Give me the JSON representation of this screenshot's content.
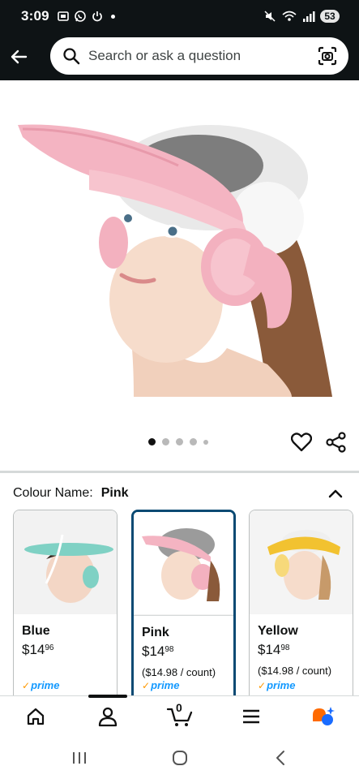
{
  "status_bar": {
    "time": "3:09",
    "battery": "53"
  },
  "search": {
    "placeholder": "Search or ask a question"
  },
  "product": {
    "image_alt": "Child wearing pink shower cap with ear covers",
    "carousel": {
      "count": 5,
      "active": 1
    }
  },
  "colour": {
    "label": "Colour Name:",
    "selected": "Pink",
    "options": [
      {
        "name": "Blue",
        "price_dollars": "$14",
        "price_cents": "96",
        "unit_price": "",
        "prime": "prime",
        "color": "#7fd1c4"
      },
      {
        "name": "Pink",
        "price_dollars": "$14",
        "price_cents": "98",
        "unit_price": "($14.98 / count)",
        "prime": "prime",
        "color": "#f2b6c0"
      },
      {
        "name": "Yellow",
        "price_dollars": "$14",
        "price_cents": "98",
        "unit_price": "($14.98 / count)",
        "prime": "prime",
        "color": "#f2c230"
      }
    ]
  },
  "bottom_nav": {
    "cart_count": "0",
    "items": [
      "home-icon",
      "account-icon",
      "cart-icon",
      "menu-icon",
      "rufus-icon"
    ]
  },
  "system_nav": {
    "items": [
      "recents-icon",
      "home-icon",
      "back-icon"
    ]
  },
  "colors": {
    "header_bg": "#0e1315",
    "selected_border": "#0a4a73",
    "prime_blue": "#1399ff",
    "prime_check": "#ff9900",
    "rufus_orange": "#ff6a00",
    "rufus_blue": "#1a6cff"
  }
}
